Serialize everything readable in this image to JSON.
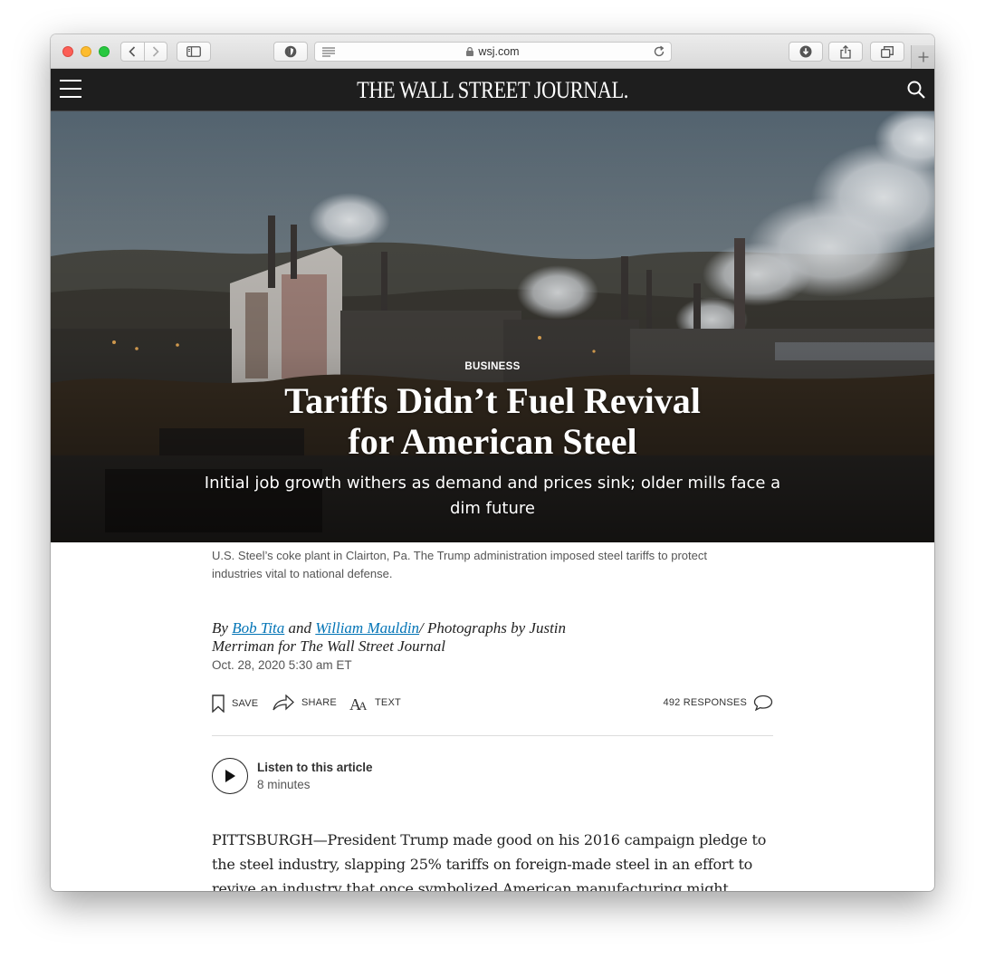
{
  "browser": {
    "url": "wsj.com"
  },
  "site": {
    "masthead": "THE WALL STREET JOURNAL."
  },
  "article": {
    "section": "BUSINESS",
    "headline": "Tariffs Didn’t Fuel Revival for American Steel",
    "dek": "Initial job growth withers as demand and prices sink; older mills face a dim future",
    "caption": "U.S. Steel’s coke plant in Clairton, Pa. The Trump administration imposed steel tariffs to protect industries vital to national defense.",
    "byline": {
      "by": "By",
      "author1": "Bob Tita",
      "and": "and",
      "author2": "William Mauldin",
      "photos": "/ Photographs by Justin Merriman for The Wall Street Journal"
    },
    "date": "Oct. 28, 2020 5:30 am ET",
    "tools": {
      "save": "SAVE",
      "share": "SHARE",
      "text": "TEXT",
      "responses": "492 RESPONSES"
    },
    "listen": {
      "title": "Listen to this article",
      "duration": "8 minutes"
    },
    "first_paragraph": "PITTSBURGH—President Trump made good on his 2016 campaign pledge to the steel industry, slapping 25% tariffs on foreign-made steel in an effort to revive an industry that once symbolized American manufacturing might."
  }
}
